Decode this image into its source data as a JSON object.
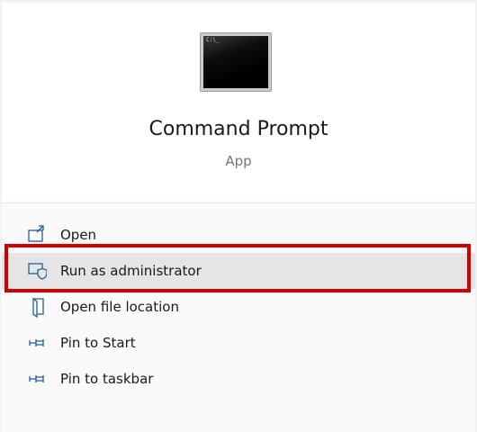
{
  "app": {
    "title": "Command Prompt",
    "type": "App",
    "icon": "command-prompt-icon",
    "icon_prompt_text": "C:\\_"
  },
  "menu": {
    "items": [
      {
        "label": "Open",
        "icon": "open-window-icon",
        "highlighted": false
      },
      {
        "label": "Run as administrator",
        "icon": "shield-icon",
        "highlighted": true
      },
      {
        "label": "Open file location",
        "icon": "folder-location-icon",
        "highlighted": false
      },
      {
        "label": "Pin to Start",
        "icon": "pin-icon",
        "highlighted": false
      },
      {
        "label": "Pin to taskbar",
        "icon": "pin-icon",
        "highlighted": false
      }
    ]
  },
  "colors": {
    "accent_icon": "#1f5f96",
    "hover_background": "#e5e5e5",
    "annotation_border": "#d40000"
  }
}
